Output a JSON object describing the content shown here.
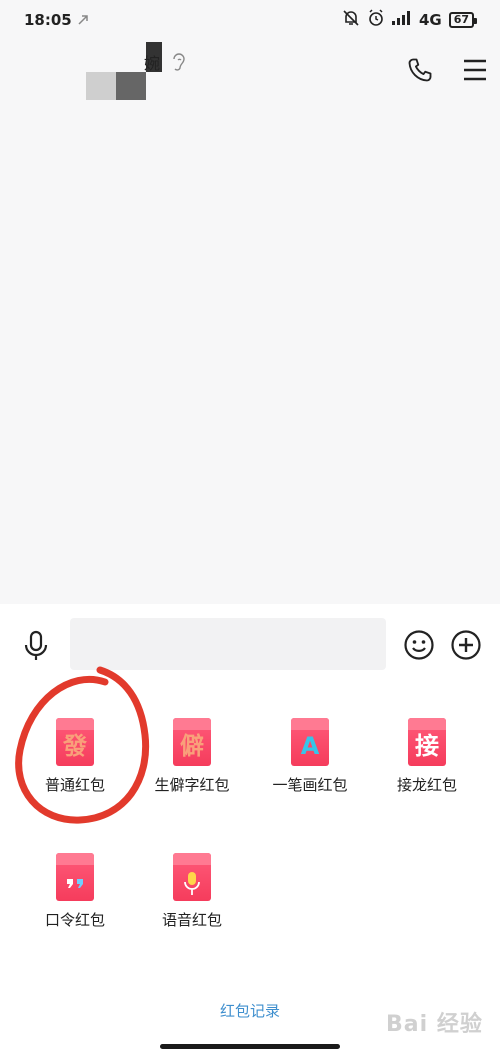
{
  "status": {
    "time": "18:05",
    "network": "4G",
    "battery": "67"
  },
  "chat_header": {
    "contact_name": "婉",
    "icons": [
      "ear-icon",
      "phone-icon",
      "menu-icon"
    ]
  },
  "composer": {
    "input_value": "",
    "icons": [
      "mic-icon",
      "emoji-icon",
      "plus-icon"
    ]
  },
  "red_packets": [
    {
      "label": "普通红包",
      "glyph": "發"
    },
    {
      "label": "生僻字红包",
      "glyph": "僻"
    },
    {
      "label": "一笔画红包",
      "glyph": "A"
    },
    {
      "label": "接龙红包",
      "glyph": "接"
    },
    {
      "label": "口令红包",
      "glyph": ""
    },
    {
      "label": "语音红包",
      "glyph": ""
    }
  ],
  "footer": {
    "records_link": "红包记录",
    "watermark": "Bai 经验"
  },
  "colors": {
    "accent_link": "#3f8fce",
    "packet_red": "#f53c5c",
    "annotation_red": "#e23a2c"
  }
}
